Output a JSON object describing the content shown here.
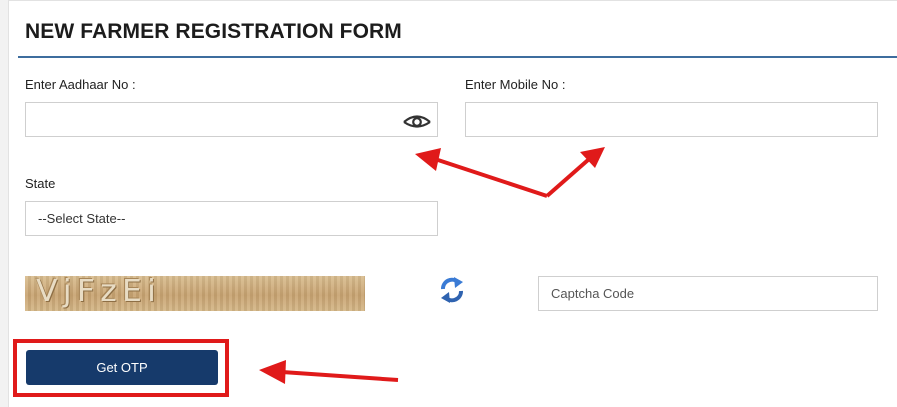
{
  "form": {
    "title": "NEW FARMER REGISTRATION FORM",
    "aadhaar_label": "Enter Aadhaar No :",
    "aadhaar_value": "",
    "mobile_label": "Enter Mobile No :",
    "mobile_value": "",
    "state_label": "State",
    "state_selected": "--Select State--",
    "captcha_text": "VjFzEi",
    "captcha_placeholder": "Captcha Code",
    "otp_button": "Get OTP"
  },
  "icons": {
    "eye": "eye-icon",
    "refresh": "refresh-icon"
  },
  "colors": {
    "accent": "#3d6d9e",
    "button": "#163a6b",
    "annotation": "#e01a1a",
    "refresh_blue": "#3a7bd5"
  }
}
